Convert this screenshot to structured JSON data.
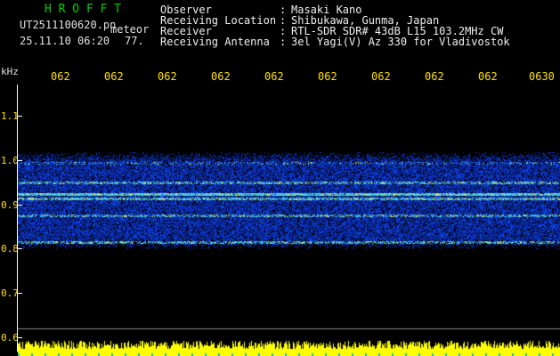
{
  "header": {
    "station_name": "H R O F F T",
    "filename": "UT2511100620.pn",
    "mode": "meteor",
    "timestamp": "25.11.10 06:20",
    "extra_count": "77.",
    "fields": [
      {
        "label": "Observer",
        "sep": ":",
        "value": "Masaki Kano"
      },
      {
        "label": "Receiving Location",
        "sep": ":",
        "value": "Shibukawa, Gunma, Japan"
      },
      {
        "label": "Receiver",
        "sep": ":",
        "value": "RTL-SDR SDR# 43dB L15 103.2MHz CW"
      },
      {
        "label": "Receiving Antenna",
        "sep": ":",
        "value": "3el Yagi(V) Az 330 for Vladivostok"
      }
    ]
  },
  "axis": {
    "unit": "kHz",
    "yticks": [
      "1.1",
      "1.0",
      "0.9",
      "0.8",
      "0.7",
      "0.6"
    ],
    "xticks": [
      "062",
      "062",
      "062",
      "062",
      "062",
      "062",
      "062",
      "062",
      "062",
      "0630"
    ]
  },
  "colors": {
    "background": "#000000",
    "title_green": "#00d000",
    "tick_yellow": "#ffe000",
    "noise_blue": "#1020c0",
    "signal_cyan": "#40e0ff",
    "strip_yellow": "#ffff00"
  },
  "icons": {
    "spectrogram": "waterfall-display"
  }
}
